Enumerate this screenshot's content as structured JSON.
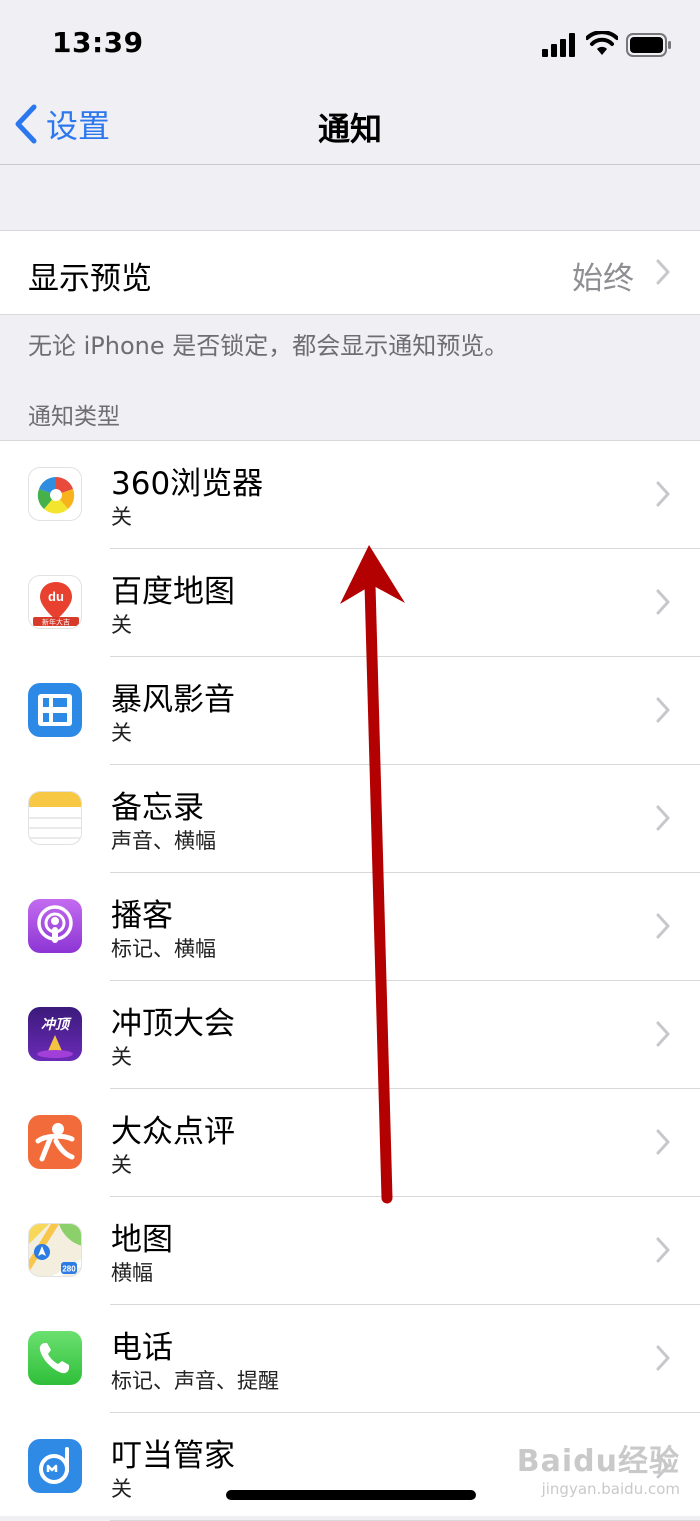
{
  "status_bar": {
    "time": "13:39"
  },
  "nav": {
    "back_label": "设置",
    "title": "通知"
  },
  "preview": {
    "label": "显示预览",
    "value": "始终",
    "note": "无论 iPhone 是否锁定，都会显示通知预览。"
  },
  "section_header": "通知类型",
  "apps": [
    {
      "name": "360浏览器",
      "sub": "关",
      "icon": "360-browser-icon"
    },
    {
      "name": "百度地图",
      "sub": "关",
      "icon": "baidu-map-icon",
      "icon_text": "du",
      "icon_caption": "新年大吉"
    },
    {
      "name": "暴风影音",
      "sub": "关",
      "icon": "baofeng-icon"
    },
    {
      "name": "备忘录",
      "sub": "声音、横幅",
      "icon": "notes-icon"
    },
    {
      "name": "播客",
      "sub": "标记、横幅",
      "icon": "podcast-icon"
    },
    {
      "name": "冲顶大会",
      "sub": "关",
      "icon": "chongding-icon",
      "icon_text": "冲顶"
    },
    {
      "name": "大众点评",
      "sub": "关",
      "icon": "dianping-icon"
    },
    {
      "name": "地图",
      "sub": "横幅",
      "icon": "maps-icon",
      "icon_text": "280"
    },
    {
      "name": "电话",
      "sub": "标记、声音、提醒",
      "icon": "phone-icon"
    },
    {
      "name": "叮当管家",
      "sub": "关",
      "icon": "dingdang-icon"
    }
  ],
  "watermark": {
    "brand": "Baidu经验",
    "url": "jingyan.baidu.com"
  },
  "colors": {
    "accent": "#2b78ee",
    "arrow": "#b30000",
    "background": "#efeff4"
  }
}
